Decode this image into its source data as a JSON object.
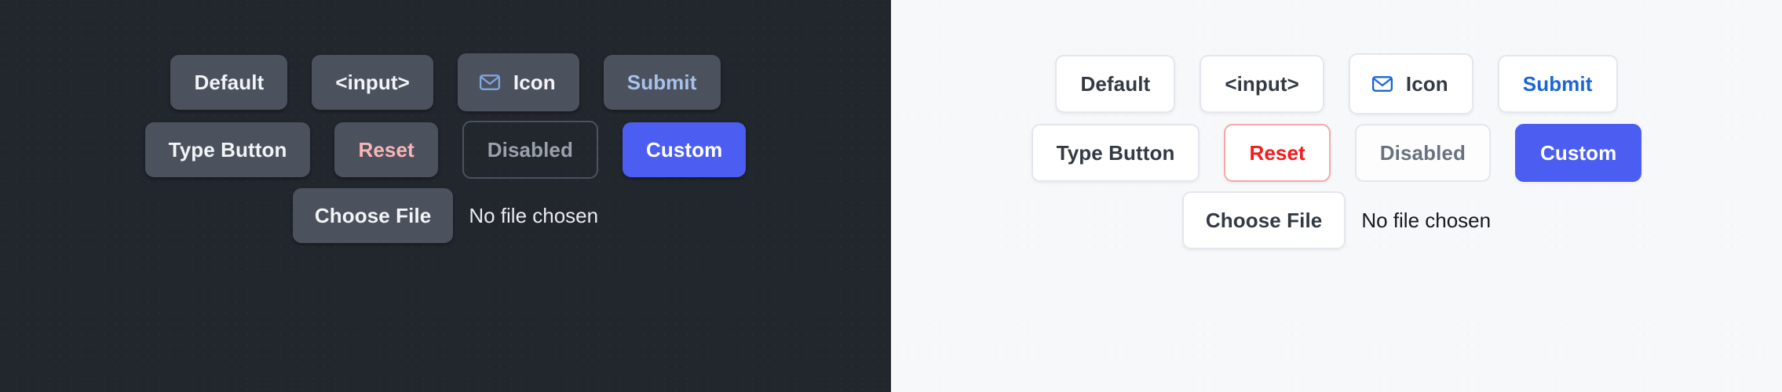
{
  "theme_colors": {
    "dark_bg": "#22262d",
    "dark_btn_bg": "#4b525e",
    "dark_text": "#f2f4f7",
    "dark_submit_text": "#a9c1ea",
    "dark_reset_text": "#f9b5b5",
    "dark_disabled_text": "#9aa1ad",
    "light_bg": "#f7f8fa",
    "light_btn_bg": "#ffffff",
    "light_border": "#e3e7ed",
    "light_text": "#333a44",
    "light_submit_text": "#1a65d8",
    "light_reset_text": "#f41b1b",
    "light_reset_border": "#f7a7a7",
    "light_disabled_text": "#6a7280",
    "custom_accent": "#4c5ef2",
    "icon_blue_dark": "#7fa5de",
    "icon_blue_light": "#1a65d8"
  },
  "dark_panel": {
    "row1": [
      {
        "label": "Default",
        "name": "default-button"
      },
      {
        "label": "<input>",
        "name": "input-button"
      },
      {
        "label": "Icon",
        "name": "icon-button",
        "icon": "mail-icon"
      },
      {
        "label": "Submit",
        "name": "submit-button"
      }
    ],
    "row2": [
      {
        "label": "Type Button",
        "name": "type-button"
      },
      {
        "label": "Reset",
        "name": "reset-button"
      },
      {
        "label": "Disabled",
        "name": "disabled-button"
      },
      {
        "label": "Custom",
        "name": "custom-button"
      }
    ],
    "file": {
      "button_label": "Choose File",
      "status": "No file chosen"
    }
  },
  "light_panel": {
    "row1": [
      {
        "label": "Default",
        "name": "default-button"
      },
      {
        "label": "<input>",
        "name": "input-button"
      },
      {
        "label": "Icon",
        "name": "icon-button",
        "icon": "mail-icon"
      },
      {
        "label": "Submit",
        "name": "submit-button"
      }
    ],
    "row2": [
      {
        "label": "Type Button",
        "name": "type-button"
      },
      {
        "label": "Reset",
        "name": "reset-button"
      },
      {
        "label": "Disabled",
        "name": "disabled-button"
      },
      {
        "label": "Custom",
        "name": "custom-button"
      }
    ],
    "file": {
      "button_label": "Choose File",
      "status": "No file chosen"
    }
  }
}
